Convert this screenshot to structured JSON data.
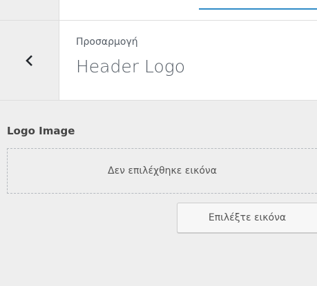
{
  "header": {
    "subtitle": "Προσαρμογή",
    "title": "Header Logo",
    "back_icon": "chevron-left-icon"
  },
  "section": {
    "label": "Logo Image",
    "placeholder_text": "Δεν επιλέχθηκε εικόνα",
    "select_button_label": "Επιλέξτε εικόνα"
  },
  "colors": {
    "accent": "#2e8ac6",
    "panel_background": "#eeeeee",
    "header_background": "#ffffff"
  }
}
